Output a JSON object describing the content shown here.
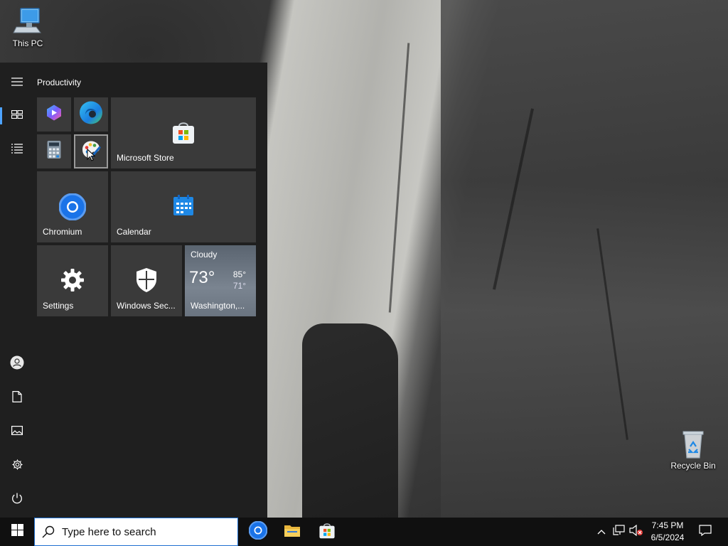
{
  "desktop": {
    "icons": [
      {
        "label": "This PC"
      },
      {
        "label": "Recycle Bin"
      }
    ]
  },
  "start_menu": {
    "group_title": "Productivity",
    "rail": [
      "menu-icon",
      "tiles-icon",
      "all-apps-icon",
      "user-icon",
      "documents-icon",
      "pictures-icon",
      "settings-icon",
      "power-icon"
    ],
    "tiles": {
      "store": {
        "label": "Microsoft Store"
      },
      "chromium": {
        "label": "Chromium"
      },
      "calendar": {
        "label": "Calendar"
      },
      "settings": {
        "label": "Settings"
      },
      "security": {
        "label": "Windows Sec..."
      },
      "weather": {
        "condition": "Cloudy",
        "temp": "73°",
        "high": "85°",
        "low": "71°",
        "location": "Washington,..."
      }
    }
  },
  "taskbar": {
    "search_placeholder": "Type here to search",
    "apps": [
      "chromium-icon",
      "file-explorer-icon",
      "microsoft-store-icon"
    ],
    "time": "7:45 PM",
    "date": "6/5/2024"
  },
  "colors": {
    "accent": "#4da3ff",
    "start_bg": "#1f1f1f",
    "tile_bg": "#3a3a3a",
    "taskbar_bg": "#101010"
  }
}
